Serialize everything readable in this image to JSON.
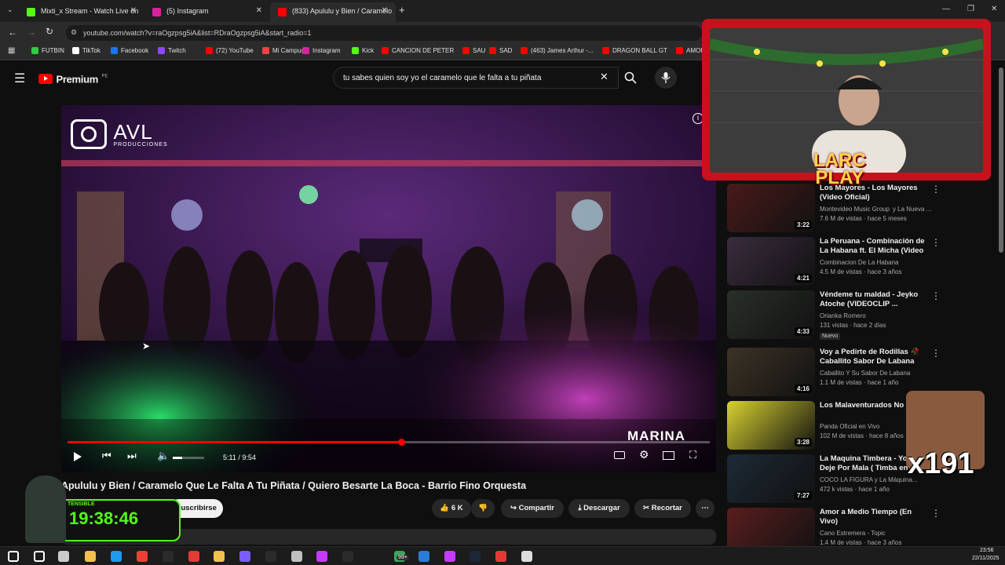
{
  "tabs": [
    {
      "label": "Mixti_x Stream - Watch Live on",
      "color": "#53fc18"
    },
    {
      "label": "(5) Instagram",
      "color": "#d6249f"
    },
    {
      "label": "(833) Apululu y Bien / Caramelo",
      "color": "#ff0000"
    }
  ],
  "address": {
    "url": "youtube.com/watch?v=raOgzpsg5iA&list=RDraOgzpsg5iA&start_radio=1"
  },
  "bookmarks": [
    {
      "label": "FUTBIN",
      "color": "#2ecc40"
    },
    {
      "label": "TikTok",
      "color": "#ffffff"
    },
    {
      "label": "Facebook",
      "color": "#1877f2"
    },
    {
      "label": "Twitch",
      "color": "#9146ff"
    },
    {
      "label": "(72) YouTube",
      "color": "#ff0000"
    },
    {
      "label": "Mi Campus",
      "color": "#e44"
    },
    {
      "label": "Instagram",
      "color": "#d6249f"
    },
    {
      "label": "Kick",
      "color": "#53fc18"
    },
    {
      "label": "CANCION DE PETER",
      "color": "#ff0000"
    },
    {
      "label": "SAU",
      "color": "#ff0000"
    },
    {
      "label": "SAD",
      "color": "#ff0000"
    },
    {
      "label": "(463) James Arthur -...",
      "color": "#ff0000"
    },
    {
      "label": "DRAGON BALL GT",
      "color": "#ff0000"
    },
    {
      "label": "AMOR",
      "color": "#ff0000"
    }
  ],
  "yt": {
    "logo": "Premium",
    "region": "PE",
    "search_value": "tu sabes quien soy yo el caramelo que le falta a tu piñata"
  },
  "video": {
    "watermark_brand": "AVL",
    "watermark_sub": "PRODUCCIONES",
    "corner_label": "MARINA",
    "time": "5:11 / 9:54",
    "progress": 0.52,
    "volume": 0.3
  },
  "title": "Apululu y Bien / Caramelo Que Le Falta A Tu Piñata / Quiero Besarte La Boca - Barrio Fino Orquesta",
  "actions": {
    "subscribe": "Suscribirse",
    "likes": "6 K",
    "share": "Compartir",
    "download": "Descargar",
    "clip": "Recortar"
  },
  "overlay": {
    "streamer": [
      "LARC",
      "PLAY"
    ],
    "timer": "19:38:46",
    "timer_caption": "TENSIBLE",
    "multiplier": "x191"
  },
  "recommendations": [
    {
      "title": "Los Mayores - Los Mayores (Video Oficial)",
      "channel": "Montevideo Music Group",
      "extra": "y La Nueva ...",
      "meta": "7.6 M de vistas · hace 5 meses",
      "duration": "3:22",
      "thumb": "#4a1a1a"
    },
    {
      "title": "La Peruana - Combinación de La Habana ft. El Micha (Video ...",
      "channel": "Combinacion De La Habana",
      "extra": "",
      "meta": "4.5 M de vistas · hace 3 años",
      "duration": "4:21",
      "thumb": "#3a2c3e"
    },
    {
      "title": "Véndeme tu maldad - Jeyko Atoche (VIDEOCLIP ...",
      "channel": "Orianka Romero",
      "extra": "",
      "meta": "131 vistas · hace 2 días",
      "duration": "4:33",
      "thumb": "#2a2f2a",
      "badge": "Nuevo"
    },
    {
      "title": "Voy a Pedirte de Rodillas 🥀 Caballito Sabor De Labana",
      "channel": "Caballito Y Su Sabor De Labana",
      "extra": "",
      "meta": "1.1 M de vistas · hace 1 año",
      "duration": "4:16",
      "thumb": "#3d3326"
    },
    {
      "title": "Los Malaventurados No Llo...",
      "channel": "Panda Oficial en Vivo",
      "extra": "",
      "meta": "102 M de vistas · hace 8 años",
      "duration": "3:28",
      "thumb": "#d8d230"
    },
    {
      "title": "La Maquina Timbera - Yo No Deje Por Mala ( Timba en e...",
      "channel": "COCO LA FIGURA y La Máquina...",
      "extra": "",
      "meta": "472 k vistas · hace 1 año",
      "duration": "7:27",
      "thumb": "#1d2a36"
    },
    {
      "title": "Amor a Medio Tiempo (En Vivo)",
      "channel": "Cano Estremera - Topic",
      "extra": "",
      "meta": "1.4 M de vistas · hace 3 años",
      "duration": "",
      "thumb": "#5a1e1e"
    }
  ],
  "clock": {
    "time": "23:56",
    "date": "22/11/2025"
  },
  "taskbar": {
    "badge": "99+"
  }
}
